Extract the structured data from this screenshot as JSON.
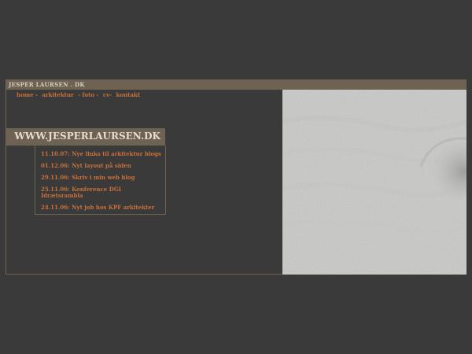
{
  "header": {
    "site_title": "JESPER LAURSEN . DK"
  },
  "nav": {
    "items": [
      {
        "label": "home -"
      },
      {
        "label": "arkitektur"
      },
      {
        "label": "- foto -"
      },
      {
        "label": "cv-"
      },
      {
        "label": "kontakt"
      }
    ]
  },
  "banner": {
    "title": "WWW.JESPERLAURSEN.DK"
  },
  "news": {
    "items": [
      {
        "text": "11.10.07: Nye links til arkitektur blogs"
      },
      {
        "text": "01.12.06: Nyt layout på siden"
      },
      {
        "text": "29.11.06: Skriv i min web blog"
      },
      {
        "text": "25.11.06: Konference DGI Idrætsrambla"
      },
      {
        "text": "24.11.06: Nyt job hos KPF arkitekter"
      }
    ]
  },
  "colors": {
    "background": "#3a3a3a",
    "accent_bar": "#6e6252",
    "link": "#c8703a",
    "sand": "#d4d4d2"
  }
}
